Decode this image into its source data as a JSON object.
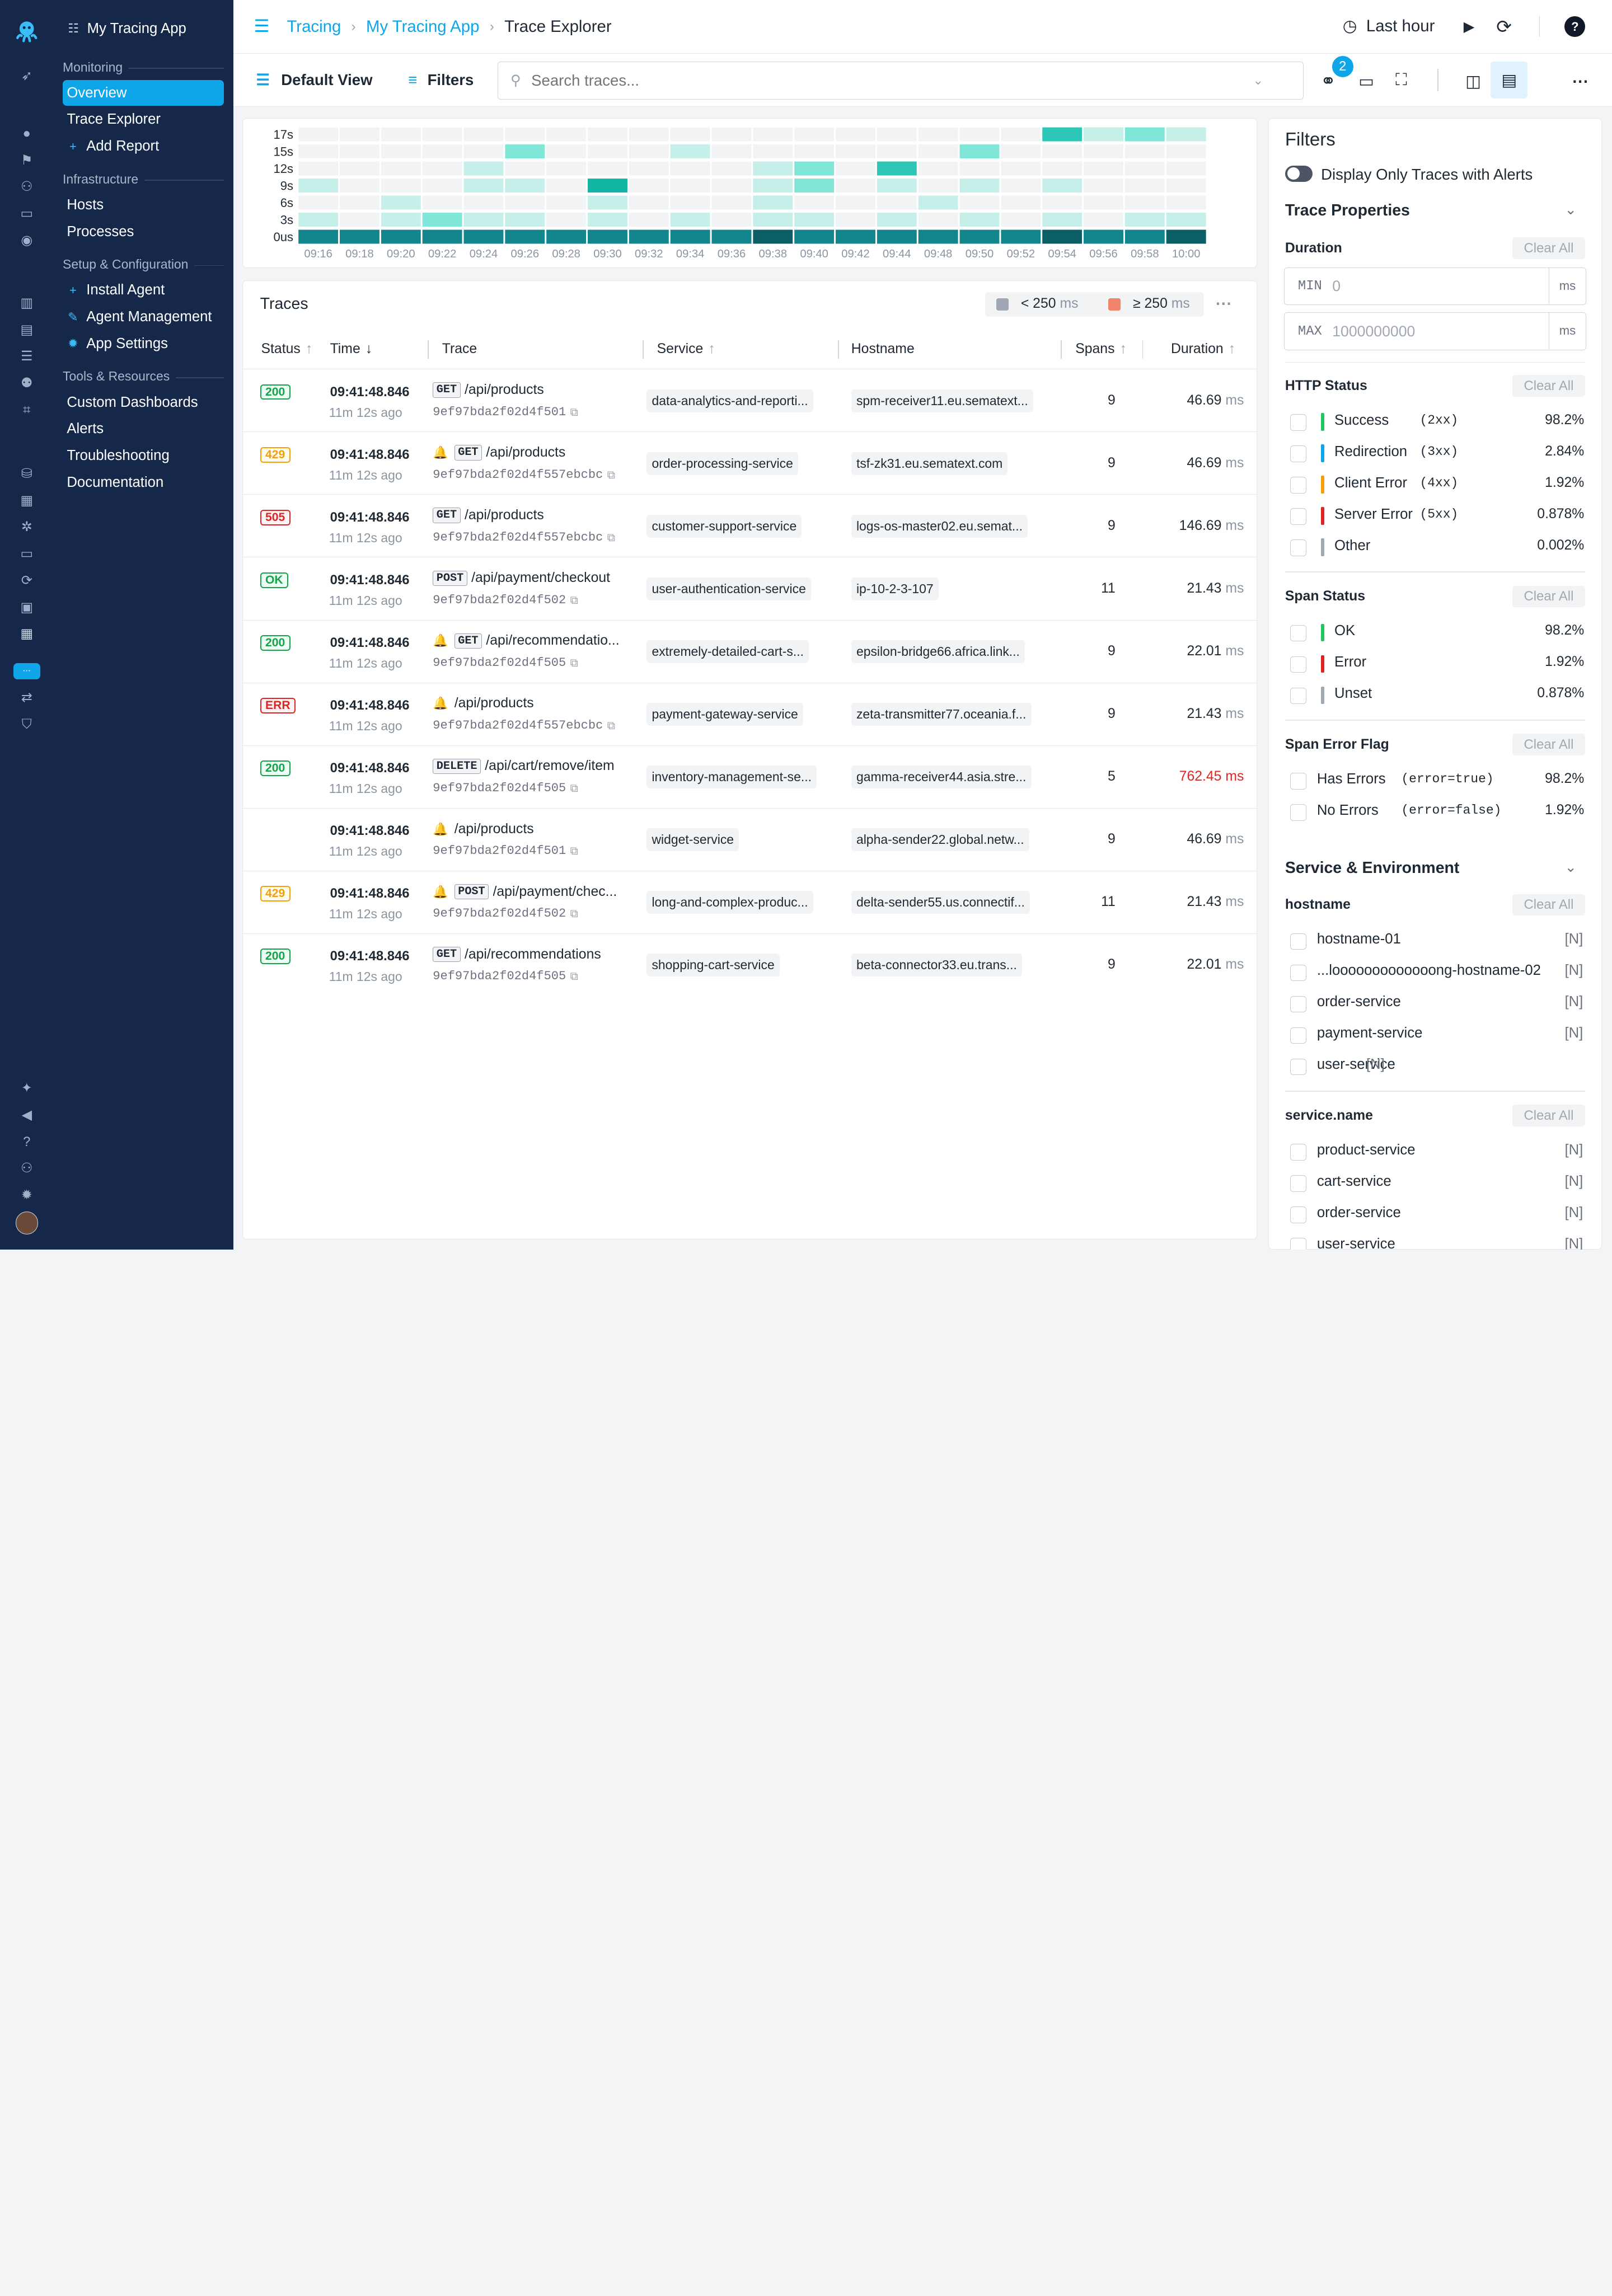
{
  "app": {
    "name": "My Tracing App"
  },
  "sidebar": {
    "sections": [
      {
        "title": "Monitoring",
        "items": [
          {
            "label": "Overview",
            "active": true
          },
          {
            "label": "Trace Explorer"
          },
          {
            "label": "Add Report",
            "icon": "plus-icon"
          }
        ]
      },
      {
        "title": "Infrastructure",
        "items": [
          {
            "label": "Hosts"
          },
          {
            "label": "Processes"
          }
        ]
      },
      {
        "title": "Setup & Configuration",
        "items": [
          {
            "label": "Install Agent",
            "icon": "plus-icon"
          },
          {
            "label": "Agent Management",
            "icon": "wrench-icon"
          },
          {
            "label": "App Settings",
            "icon": "gear-icon"
          }
        ]
      },
      {
        "title": "Tools & Resources",
        "items": [
          {
            "label": "Custom Dashboards"
          },
          {
            "label": "Alerts"
          },
          {
            "label": "Troubleshooting"
          },
          {
            "label": "Documentation"
          }
        ]
      }
    ]
  },
  "breadcrumb": [
    "Tracing",
    "My Tracing App",
    "Trace Explorer"
  ],
  "topbar": {
    "time_range": "Last hour"
  },
  "toolbar": {
    "view": "Default View",
    "filters": "Filters",
    "search_placeholder": "Search traces...",
    "link_count": "2"
  },
  "heatmap": {
    "y_labels": [
      "17s",
      "15s",
      "12s",
      "9s",
      "6s",
      "3s",
      "0us"
    ],
    "x_labels": [
      "09:16",
      "09:18",
      "09:20",
      "09:22",
      "09:24",
      "09:26",
      "09:28",
      "09:30",
      "09:32",
      "09:34",
      "09:36",
      "09:38",
      "09:40",
      "09:42",
      "09:44",
      "09:48",
      "09:50",
      "09:52",
      "09:54",
      "09:56",
      "09:58",
      "10:00"
    ],
    "intensity_levels": [
      [
        0,
        0,
        0,
        0,
        0,
        0,
        0,
        0,
        0,
        0,
        0,
        0,
        0,
        0,
        0,
        0,
        0,
        0,
        0,
        0,
        0,
        0
      ],
      [
        0,
        0,
        0,
        0,
        0,
        0,
        0,
        0,
        0,
        0,
        0,
        0,
        0,
        0,
        0,
        0,
        0,
        0,
        3,
        1,
        2,
        1
      ],
      [
        0,
        0,
        0,
        0,
        0,
        2,
        0,
        0,
        0,
        1,
        0,
        0,
        0,
        0,
        0,
        0,
        2,
        0,
        0,
        0,
        0,
        0
      ],
      [
        0,
        0,
        0,
        0,
        1,
        0,
        0,
        0,
        0,
        0,
        0,
        1,
        2,
        0,
        3,
        0,
        0,
        0,
        0,
        0,
        0,
        0
      ],
      [
        1,
        0,
        0,
        0,
        1,
        1,
        0,
        4,
        0,
        0,
        0,
        1,
        2,
        0,
        1,
        0,
        1,
        0,
        1,
        0,
        0,
        0
      ],
      [
        0,
        0,
        1,
        0,
        0,
        0,
        0,
        1,
        0,
        0,
        0,
        1,
        0,
        0,
        0,
        1,
        0,
        0,
        0,
        0,
        0,
        0
      ],
      [
        1,
        0,
        1,
        2,
        1,
        1,
        0,
        1,
        0,
        1,
        0,
        1,
        1,
        0,
        1,
        0,
        1,
        0,
        1,
        0,
        1,
        1
      ],
      [
        5,
        5,
        5,
        5,
        5,
        5,
        5,
        5,
        5,
        5,
        5,
        6,
        5,
        5,
        5,
        5,
        5,
        5,
        6,
        5,
        5,
        6
      ]
    ],
    "colors": [
      "#f1f3f5",
      "#c5efe8",
      "#7fe6d8",
      "#2dc7b7",
      "#13b5a5",
      "#13858d",
      "#0b5e66"
    ]
  },
  "traces": {
    "title": "Traces",
    "legend": [
      {
        "label": "< 250",
        "unit": "ms",
        "color": "#a0a8b3"
      },
      {
        "label": "≥ 250",
        "unit": "ms",
        "color": "#f0846a"
      }
    ],
    "columns": [
      "Status",
      "Time",
      "Trace",
      "Service",
      "Hostname",
      "Spans",
      "Duration"
    ],
    "rows": [
      {
        "status": "200",
        "time": "09:41:48.846",
        "ago": "11m 12s ago",
        "alert": false,
        "method": "GET",
        "path": "/api/products",
        "id": "9ef97bda2f02d4f501",
        "service": "data-analytics-and-reporti...",
        "host": "spm-receiver11.eu.sematext...",
        "spans": "9",
        "duration": "46.69",
        "unit": "ms",
        "slow": false
      },
      {
        "status": "429",
        "time": "09:41:48.846",
        "ago": "11m 12s ago",
        "alert": true,
        "method": "GET",
        "path": "/api/products",
        "id": "9ef97bda2f02d4f557ebcbc",
        "service": "order-processing-service",
        "host": "tsf-zk31.eu.sematext.com",
        "spans": "9",
        "duration": "46.69",
        "unit": "ms",
        "slow": false
      },
      {
        "status": "505",
        "time": "09:41:48.846",
        "ago": "11m 12s ago",
        "alert": false,
        "method": "GET",
        "path": "/api/products",
        "id": "9ef97bda2f02d4f557ebcbc",
        "service": "customer-support-service",
        "host": "logs-os-master02.eu.semat...",
        "spans": "9",
        "duration": "146.69",
        "unit": "ms",
        "slow": false
      },
      {
        "status": "OK",
        "time": "09:41:48.846",
        "ago": "11m 12s ago",
        "alert": false,
        "method": "POST",
        "path": "/api/payment/checkout",
        "id": "9ef97bda2f02d4f502",
        "service": "user-authentication-service",
        "host": "ip-10-2-3-107",
        "spans": "11",
        "duration": "21.43",
        "unit": "ms",
        "slow": false
      },
      {
        "status": "200",
        "time": "09:41:48.846",
        "ago": "11m 12s ago",
        "alert": true,
        "method": "GET",
        "path": "/api/recommendatio...",
        "id": "9ef97bda2f02d4f505",
        "service": "extremely-detailed-cart-s...",
        "host": "epsilon-bridge66.africa.link...",
        "spans": "9",
        "duration": "22.01",
        "unit": "ms",
        "slow": false
      },
      {
        "status": "ERR",
        "time": "09:41:48.846",
        "ago": "11m 12s ago",
        "alert": true,
        "method": "",
        "path": "/api/products",
        "id": "9ef97bda2f02d4f557ebcbc",
        "service": "payment-gateway-service",
        "host": "zeta-transmitter77.oceania.f...",
        "spans": "9",
        "duration": "21.43",
        "unit": "ms",
        "slow": false
      },
      {
        "status": "200",
        "time": "09:41:48.846",
        "ago": "11m 12s ago",
        "alert": false,
        "method": "DELETE",
        "path": "/api/cart/remove/item",
        "id": "9ef97bda2f02d4f505",
        "service": "inventory-management-se...",
        "host": "gamma-receiver44.asia.stre...",
        "spans": "5",
        "duration": "762.45",
        "unit": "ms",
        "slow": true
      },
      {
        "status": "",
        "time": "09:41:48.846",
        "ago": "11m 12s ago",
        "alert": true,
        "method": "",
        "path": "/api/products",
        "id": "9ef97bda2f02d4f501",
        "service": "widget-service",
        "host": "alpha-sender22.global.netw...",
        "spans": "9",
        "duration": "46.69",
        "unit": "ms",
        "slow": false
      },
      {
        "status": "429",
        "time": "09:41:48.846",
        "ago": "11m 12s ago",
        "alert": true,
        "method": "POST",
        "path": "/api/payment/chec...",
        "id": "9ef97bda2f02d4f502",
        "service": "long-and-complex-produc...",
        "host": "delta-sender55.us.connectif...",
        "spans": "11",
        "duration": "21.43",
        "unit": "ms",
        "slow": false
      },
      {
        "status": "200",
        "time": "09:41:48.846",
        "ago": "11m 12s ago",
        "alert": false,
        "method": "GET",
        "path": "/api/recommendations",
        "id": "9ef97bda2f02d4f505",
        "service": "shopping-cart-service",
        "host": "beta-connector33.eu.trans...",
        "spans": "9",
        "duration": "22.01",
        "unit": "ms",
        "slow": false
      }
    ]
  },
  "filters": {
    "title": "Filters",
    "alerts_toggle": "Display Only Traces with Alerts",
    "trace_properties": "Trace Properties",
    "duration": {
      "title": "Duration",
      "clear": "Clear All",
      "min_label": "MIN",
      "min_value": "0",
      "max_label": "MAX",
      "max_value": "1000000000",
      "unit": "ms"
    },
    "http_status": {
      "title": "HTTP Status",
      "clear": "Clear All",
      "options": [
        {
          "label": "Success",
          "code": "(2xx)",
          "pct": "98.2%",
          "color": "#22c55e"
        },
        {
          "label": "Redirection",
          "code": "(3xx)",
          "pct": "2.84%",
          "color": "#0ea5e9"
        },
        {
          "label": "Client Error",
          "code": "(4xx)",
          "pct": "1.92%",
          "color": "#f59e0b"
        },
        {
          "label": "Server Error",
          "code": "(5xx)",
          "pct": "0.878%",
          "color": "#dc2626"
        },
        {
          "label": "Other",
          "code": "",
          "pct": "0.002%",
          "color": "#a0a8b3"
        }
      ]
    },
    "span_status": {
      "title": "Span Status",
      "clear": "Clear All",
      "options": [
        {
          "label": "OK",
          "pct": "98.2%",
          "color": "#22c55e"
        },
        {
          "label": "Error",
          "pct": "1.92%",
          "color": "#dc2626"
        },
        {
          "label": "Unset",
          "pct": "0.878%",
          "color": "#a0a8b3"
        }
      ]
    },
    "span_error": {
      "title": "Span Error Flag",
      "clear": "Clear All",
      "options": [
        {
          "label": "Has Errors",
          "code": "(error=true)",
          "pct": "98.2%"
        },
        {
          "label": "No Errors",
          "code": "(error=false)",
          "pct": "1.92%"
        }
      ]
    },
    "service_env": "Service & Environment",
    "hostname": {
      "title": "hostname",
      "clear": "Clear All",
      "options": [
        {
          "label": "hostname-01",
          "count": "[N]"
        },
        {
          "label": "...looooooooooooong-hostname-02",
          "count": "[N]"
        },
        {
          "label": "order-service",
          "count": "[N]"
        },
        {
          "label": "payment-service",
          "count": "[N]"
        },
        {
          "label": "user-service",
          "count": "[N]"
        }
      ]
    },
    "service_name": {
      "title": "service.name",
      "clear": "Clear All",
      "options": [
        {
          "label": "product-service",
          "count": "[N]"
        },
        {
          "label": "cart-service",
          "count": "[N]"
        },
        {
          "label": "order-service",
          "count": "[N]"
        },
        {
          "label": "user-service",
          "count": "[N]"
        }
      ]
    }
  }
}
